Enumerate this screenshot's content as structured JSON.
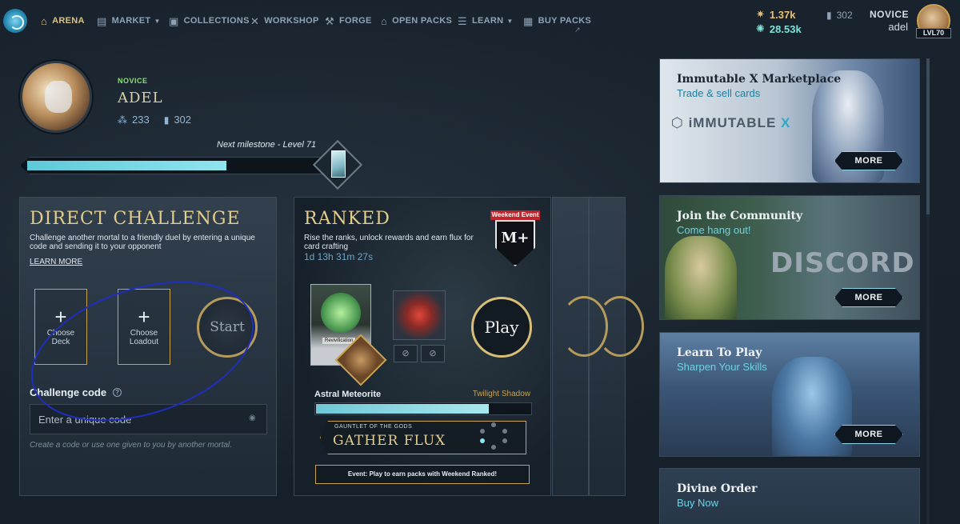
{
  "nav": {
    "items": [
      {
        "label": "ARENA",
        "icon": "arena-icon",
        "active": true
      },
      {
        "label": "MARKET",
        "icon": "market-icon",
        "dropdown": true
      },
      {
        "label": "COLLECTIONS",
        "icon": "collections-icon"
      },
      {
        "label": "WORKSHOP",
        "icon": "workshop-icon"
      },
      {
        "label": "FORGE",
        "icon": "forge-icon"
      },
      {
        "label": "OPEN PACKS",
        "icon": "open-packs-icon"
      },
      {
        "label": "LEARN",
        "icon": "learn-icon",
        "dropdown": true
      },
      {
        "label": "BUY PACKS",
        "icon": "buy-packs-icon",
        "external": true
      }
    ],
    "ext_glyph": "↗"
  },
  "resources": {
    "gold": "1.37k",
    "flux": "28.53k",
    "cards": "302"
  },
  "user": {
    "rank": "NOVICE",
    "username": "adel",
    "level_badge": "LVL70"
  },
  "profile": {
    "rank": "NOVICE",
    "name": "ADEL",
    "stat_wins": "233",
    "stat_cards": "302",
    "milestone_label": "Next milestone - Level 71",
    "xp_progress": 0.63
  },
  "direct_challenge": {
    "title": "DIRECT CHALLENGE",
    "description": "Challenge another mortal to a friendly duel by entering a unique code and sending it to your opponent",
    "learn_more": "LEARN MORE",
    "choose_deck": "Choose Deck",
    "choose_loadout": "Choose Loadout",
    "plus": "+",
    "start": "Start",
    "code_label": "Challenge code",
    "help": "?",
    "code_placeholder": "Enter a unique code",
    "hint": "Create a code or use one given to you by another mortal."
  },
  "ranked": {
    "title": "RANKED",
    "description": "Rise the ranks, unlock rewards and earn flux for card crafting",
    "timer": "1d 13h 31m 27s",
    "event_badge": "Weekend Event",
    "shield_label": "M+",
    "card_name": "Revivification",
    "play": "Play",
    "deck_name": "Astral Meteorite",
    "deck_alt": "Twilight Shadow",
    "deck_progress": 0.8,
    "ban_glyph": "⊘",
    "gauntlet_sub": "GAUNTLET OF THE GODS",
    "gauntlet_title": "GATHER FLUX",
    "event_text": "Event: Play to earn packs with Weekend Ranked!"
  },
  "promos": [
    {
      "title": "Immutable X Marketplace",
      "subtitle": "Trade & sell cards",
      "logo": "iMMUTABLE",
      "logo_x": "X",
      "button": "MORE"
    },
    {
      "title": "Join the Community",
      "subtitle": "Come hang out!",
      "logo": "DISCORD",
      "button": "MORE"
    },
    {
      "title": "Learn To Play",
      "subtitle": "Sharpen Your Skills",
      "button": "MORE"
    },
    {
      "title": "Divine Order",
      "subtitle": "Buy Now"
    }
  ],
  "colors": {
    "background": "#17212b",
    "accent_gold": "#e2cd8d",
    "accent_teal": "#6fd3e3",
    "rank_green": "#8ee07a"
  }
}
